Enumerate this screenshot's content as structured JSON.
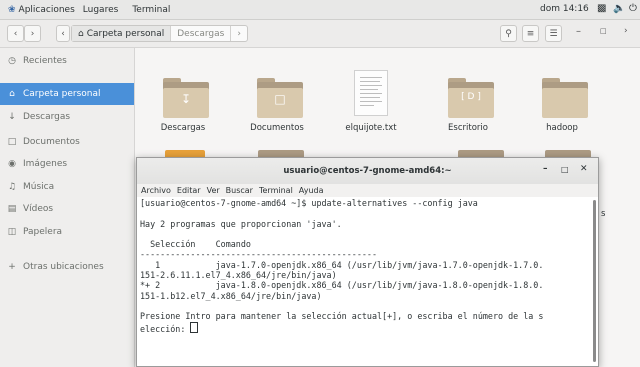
{
  "topbar": {
    "applications": "Aplicaciones",
    "places": "Lugares",
    "active_app": "Terminal",
    "clock": "dom 14:16"
  },
  "headerbar": {
    "home_crumb": "Carpeta personal",
    "current_crumb": "Descargas"
  },
  "sidebar": {
    "items": [
      {
        "label": "Recientes",
        "icon": "clock-icon"
      },
      {
        "label": "Carpeta personal",
        "icon": "home-icon"
      },
      {
        "label": "Descargas",
        "icon": "download-icon"
      },
      {
        "label": "Documentos",
        "icon": "document-icon"
      },
      {
        "label": "Imágenes",
        "icon": "camera-icon"
      },
      {
        "label": "Música",
        "icon": "music-icon"
      },
      {
        "label": "Vídeos",
        "icon": "video-icon"
      },
      {
        "label": "Papelera",
        "icon": "trash-icon"
      },
      {
        "label": "Otras ubicaciones",
        "icon": "plus-icon"
      }
    ]
  },
  "files": [
    {
      "name": "Descargas",
      "type": "folder"
    },
    {
      "name": "Documentos",
      "type": "folder"
    },
    {
      "name": "elquijote.txt",
      "type": "text"
    },
    {
      "name": "Escritorio",
      "type": "folder"
    },
    {
      "name": "hadoop",
      "type": "folder"
    }
  ],
  "terminal": {
    "title": "usuario@centos-7-gnome-amd64:~",
    "menu": [
      "Archivo",
      "Editar",
      "Ver",
      "Buscar",
      "Terminal",
      "Ayuda"
    ],
    "lines": [
      "[usuario@centos-7-gnome-amd64 ~]$ update-alternatives --config java",
      "",
      "Hay 2 programas que proporcionan 'java'.",
      "",
      "  Selección    Comando",
      "-----------------------------------------------",
      "   1           java-1.7.0-openjdk.x86_64 (/usr/lib/jvm/java-1.7.0-openjdk-1.7.0.",
      "151-2.6.11.1.el7_4.x86_64/jre/bin/java)",
      "*+ 2           java-1.8.0-openjdk.x86_64 (/usr/lib/jvm/java-1.8.0-openjdk-1.8.0.",
      "151-1.b12.el7_4.x86_64/jre/bin/java)",
      "",
      "Presione Intro para mantener la selección actual[+], o escriba el número de la s",
      "elección: "
    ]
  },
  "colors": {
    "accent": "#4a90d9",
    "folder": "#d9c9ad"
  }
}
